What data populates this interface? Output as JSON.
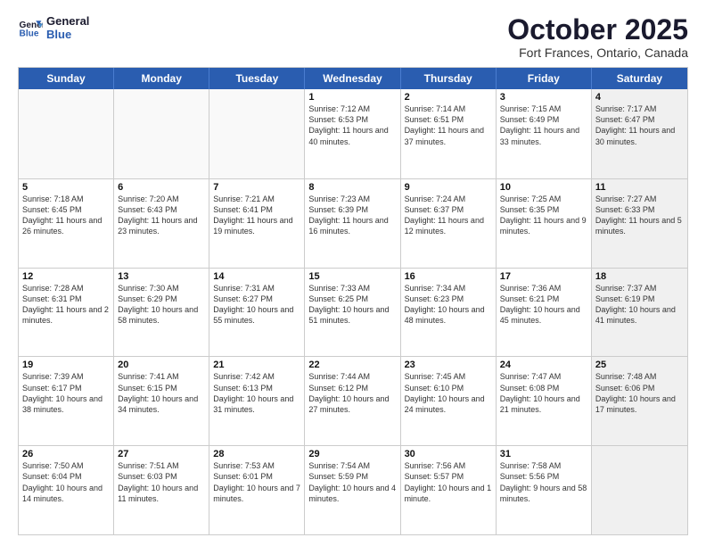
{
  "header": {
    "logo_line1": "General",
    "logo_line2": "Blue",
    "month": "October 2025",
    "location": "Fort Frances, Ontario, Canada"
  },
  "weekdays": [
    "Sunday",
    "Monday",
    "Tuesday",
    "Wednesday",
    "Thursday",
    "Friday",
    "Saturday"
  ],
  "rows": [
    [
      {
        "day": "",
        "text": "",
        "empty": true
      },
      {
        "day": "",
        "text": "",
        "empty": true
      },
      {
        "day": "",
        "text": "",
        "empty": true
      },
      {
        "day": "1",
        "text": "Sunrise: 7:12 AM\nSunset: 6:53 PM\nDaylight: 11 hours and 40 minutes."
      },
      {
        "day": "2",
        "text": "Sunrise: 7:14 AM\nSunset: 6:51 PM\nDaylight: 11 hours and 37 minutes."
      },
      {
        "day": "3",
        "text": "Sunrise: 7:15 AM\nSunset: 6:49 PM\nDaylight: 11 hours and 33 minutes."
      },
      {
        "day": "4",
        "text": "Sunrise: 7:17 AM\nSunset: 6:47 PM\nDaylight: 11 hours and 30 minutes.",
        "shaded": true
      }
    ],
    [
      {
        "day": "5",
        "text": "Sunrise: 7:18 AM\nSunset: 6:45 PM\nDaylight: 11 hours and 26 minutes."
      },
      {
        "day": "6",
        "text": "Sunrise: 7:20 AM\nSunset: 6:43 PM\nDaylight: 11 hours and 23 minutes."
      },
      {
        "day": "7",
        "text": "Sunrise: 7:21 AM\nSunset: 6:41 PM\nDaylight: 11 hours and 19 minutes."
      },
      {
        "day": "8",
        "text": "Sunrise: 7:23 AM\nSunset: 6:39 PM\nDaylight: 11 hours and 16 minutes."
      },
      {
        "day": "9",
        "text": "Sunrise: 7:24 AM\nSunset: 6:37 PM\nDaylight: 11 hours and 12 minutes."
      },
      {
        "day": "10",
        "text": "Sunrise: 7:25 AM\nSunset: 6:35 PM\nDaylight: 11 hours and 9 minutes."
      },
      {
        "day": "11",
        "text": "Sunrise: 7:27 AM\nSunset: 6:33 PM\nDaylight: 11 hours and 5 minutes.",
        "shaded": true
      }
    ],
    [
      {
        "day": "12",
        "text": "Sunrise: 7:28 AM\nSunset: 6:31 PM\nDaylight: 11 hours and 2 minutes."
      },
      {
        "day": "13",
        "text": "Sunrise: 7:30 AM\nSunset: 6:29 PM\nDaylight: 10 hours and 58 minutes."
      },
      {
        "day": "14",
        "text": "Sunrise: 7:31 AM\nSunset: 6:27 PM\nDaylight: 10 hours and 55 minutes."
      },
      {
        "day": "15",
        "text": "Sunrise: 7:33 AM\nSunset: 6:25 PM\nDaylight: 10 hours and 51 minutes."
      },
      {
        "day": "16",
        "text": "Sunrise: 7:34 AM\nSunset: 6:23 PM\nDaylight: 10 hours and 48 minutes."
      },
      {
        "day": "17",
        "text": "Sunrise: 7:36 AM\nSunset: 6:21 PM\nDaylight: 10 hours and 45 minutes."
      },
      {
        "day": "18",
        "text": "Sunrise: 7:37 AM\nSunset: 6:19 PM\nDaylight: 10 hours and 41 minutes.",
        "shaded": true
      }
    ],
    [
      {
        "day": "19",
        "text": "Sunrise: 7:39 AM\nSunset: 6:17 PM\nDaylight: 10 hours and 38 minutes."
      },
      {
        "day": "20",
        "text": "Sunrise: 7:41 AM\nSunset: 6:15 PM\nDaylight: 10 hours and 34 minutes."
      },
      {
        "day": "21",
        "text": "Sunrise: 7:42 AM\nSunset: 6:13 PM\nDaylight: 10 hours and 31 minutes."
      },
      {
        "day": "22",
        "text": "Sunrise: 7:44 AM\nSunset: 6:12 PM\nDaylight: 10 hours and 27 minutes."
      },
      {
        "day": "23",
        "text": "Sunrise: 7:45 AM\nSunset: 6:10 PM\nDaylight: 10 hours and 24 minutes."
      },
      {
        "day": "24",
        "text": "Sunrise: 7:47 AM\nSunset: 6:08 PM\nDaylight: 10 hours and 21 minutes."
      },
      {
        "day": "25",
        "text": "Sunrise: 7:48 AM\nSunset: 6:06 PM\nDaylight: 10 hours and 17 minutes.",
        "shaded": true
      }
    ],
    [
      {
        "day": "26",
        "text": "Sunrise: 7:50 AM\nSunset: 6:04 PM\nDaylight: 10 hours and 14 minutes."
      },
      {
        "day": "27",
        "text": "Sunrise: 7:51 AM\nSunset: 6:03 PM\nDaylight: 10 hours and 11 minutes."
      },
      {
        "day": "28",
        "text": "Sunrise: 7:53 AM\nSunset: 6:01 PM\nDaylight: 10 hours and 7 minutes."
      },
      {
        "day": "29",
        "text": "Sunrise: 7:54 AM\nSunset: 5:59 PM\nDaylight: 10 hours and 4 minutes."
      },
      {
        "day": "30",
        "text": "Sunrise: 7:56 AM\nSunset: 5:57 PM\nDaylight: 10 hours and 1 minute."
      },
      {
        "day": "31",
        "text": "Sunrise: 7:58 AM\nSunset: 5:56 PM\nDaylight: 9 hours and 58 minutes."
      },
      {
        "day": "",
        "text": "",
        "empty": true,
        "shaded": true
      }
    ]
  ]
}
